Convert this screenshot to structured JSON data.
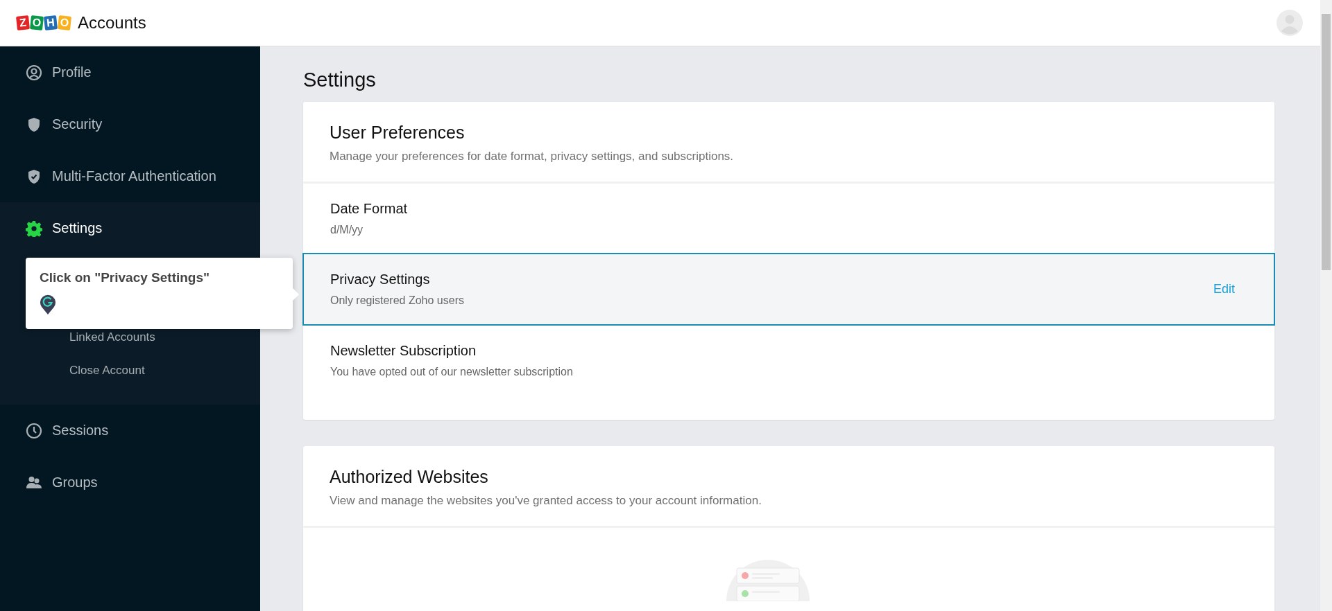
{
  "header": {
    "logo_letters": [
      {
        "letter": "Z",
        "color": "#e42527"
      },
      {
        "letter": "O",
        "color": "#089949"
      },
      {
        "letter": "H",
        "color": "#226db4"
      },
      {
        "letter": "O",
        "color": "#f9b21d"
      }
    ],
    "app_name": "Accounts"
  },
  "sidebar": {
    "items": [
      {
        "kind": "profile",
        "label": "Profile",
        "selected": false
      },
      {
        "kind": "security",
        "label": "Security",
        "selected": false
      },
      {
        "kind": "mfa",
        "label": "Multi-Factor Authentication",
        "selected": false
      },
      {
        "kind": "settings",
        "label": "Settings",
        "selected": true,
        "children": [
          {
            "label": "Linked Accounts"
          },
          {
            "label": "Close Account"
          }
        ]
      },
      {
        "kind": "sessions",
        "label": "Sessions",
        "selected": false
      },
      {
        "kind": "groups",
        "label": "Groups",
        "selected": false
      }
    ]
  },
  "tooltip": {
    "text": "Click on \"Privacy Settings\""
  },
  "page_title": "Settings",
  "cards": [
    {
      "title": "User Preferences",
      "description": "Manage your preferences for date format, privacy settings, and subscriptions.",
      "rows": [
        {
          "title": "Date Format",
          "value": "d/M/yy",
          "highlighted": false
        },
        {
          "title": "Privacy Settings",
          "value": "Only registered Zoho users",
          "highlighted": true,
          "action": "Edit"
        },
        {
          "title": "Newsletter Subscription",
          "value": "You have opted out of our newsletter subscription",
          "highlighted": false
        }
      ]
    },
    {
      "title": "Authorized Websites",
      "description": "View and manage the websites you've granted access to your account information.",
      "empty_state": true
    }
  ]
}
